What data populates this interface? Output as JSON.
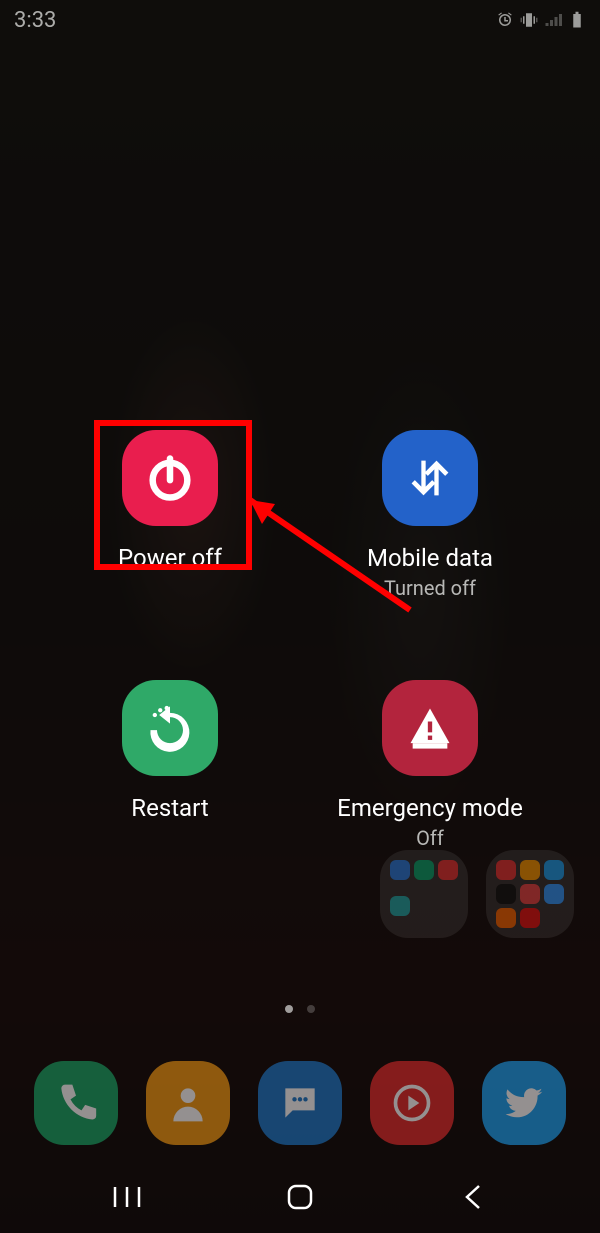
{
  "status": {
    "time": "3:33",
    "icons": {
      "alarm": "alarm-icon",
      "vibrate": "vibrate-icon",
      "signal": "signal-icon",
      "battery": "battery-icon"
    }
  },
  "powerMenu": {
    "powerOff": {
      "label": "Power off",
      "color": "#e91e4e"
    },
    "mobileData": {
      "label": "Mobile data",
      "sub": "Turned off",
      "color": "#2362c9"
    },
    "restart": {
      "label": "Restart",
      "color": "#2fa968"
    },
    "emergency": {
      "label": "Emergency mode",
      "sub": "Off",
      "color": "#b3243d"
    }
  },
  "dock": {
    "phone": "phone-icon",
    "contacts": "contacts-icon",
    "messages": "messages-icon",
    "youtubeMusic": "yt-music-icon",
    "twitter": "twitter-icon"
  },
  "nav": {
    "recents": "recents",
    "home": "home",
    "back": "back"
  },
  "annotation": {
    "highlight": "Power off",
    "arrowFrom": "Mobile data area",
    "arrowTo": "Power off"
  }
}
